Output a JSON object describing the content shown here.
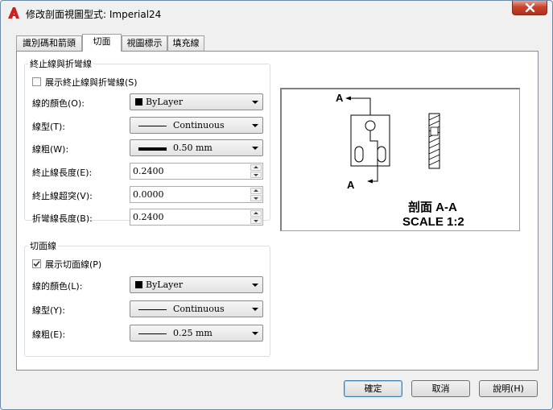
{
  "window": {
    "title": "修改剖面視圖型式: Imperial24"
  },
  "tabs": [
    {
      "label": "識別碼和箭頭"
    },
    {
      "label": "切面"
    },
    {
      "label": "視圖標示"
    },
    {
      "label": "填充線"
    }
  ],
  "end_lines_group": {
    "title": "終止線與折彎線",
    "show_checkbox": {
      "label": "展示終止線與折彎線(S)",
      "checked": false
    },
    "color": {
      "label": "線的顏色(O):",
      "value": "ByLayer"
    },
    "linetype": {
      "label": "線型(T):",
      "value": "Continuous"
    },
    "lineweight": {
      "label": "線粗(W):",
      "value": "0.50 mm"
    },
    "end_line_length": {
      "label": "終止線長度(E):",
      "value": "0.2400"
    },
    "end_line_overshoot": {
      "label": "終止線超突(V):",
      "value": "0.0000"
    },
    "bend_line_length": {
      "label": "折彎線長度(B):",
      "value": "0.2400"
    }
  },
  "cutting_plane_group": {
    "title": "切面線",
    "show_checkbox": {
      "label": "展示切面線(P)",
      "checked": true
    },
    "color": {
      "label": "線的顏色(L):",
      "value": "ByLayer"
    },
    "linetype": {
      "label": "線型(Y):",
      "value": "Continuous"
    },
    "lineweight": {
      "label": "線粗(E):",
      "value": "0.25 mm"
    }
  },
  "preview": {
    "marker_top": "A",
    "marker_bottom": "A",
    "label_line1": "剖面 A-A",
    "label_line2": "SCALE 1:2"
  },
  "buttons": {
    "ok": "確定",
    "cancel": "取消",
    "help": "說明(H)"
  },
  "colors": {
    "accent": "#cc1f1f",
    "close": "#c8442d",
    "default_button": "#3c7fb1"
  }
}
